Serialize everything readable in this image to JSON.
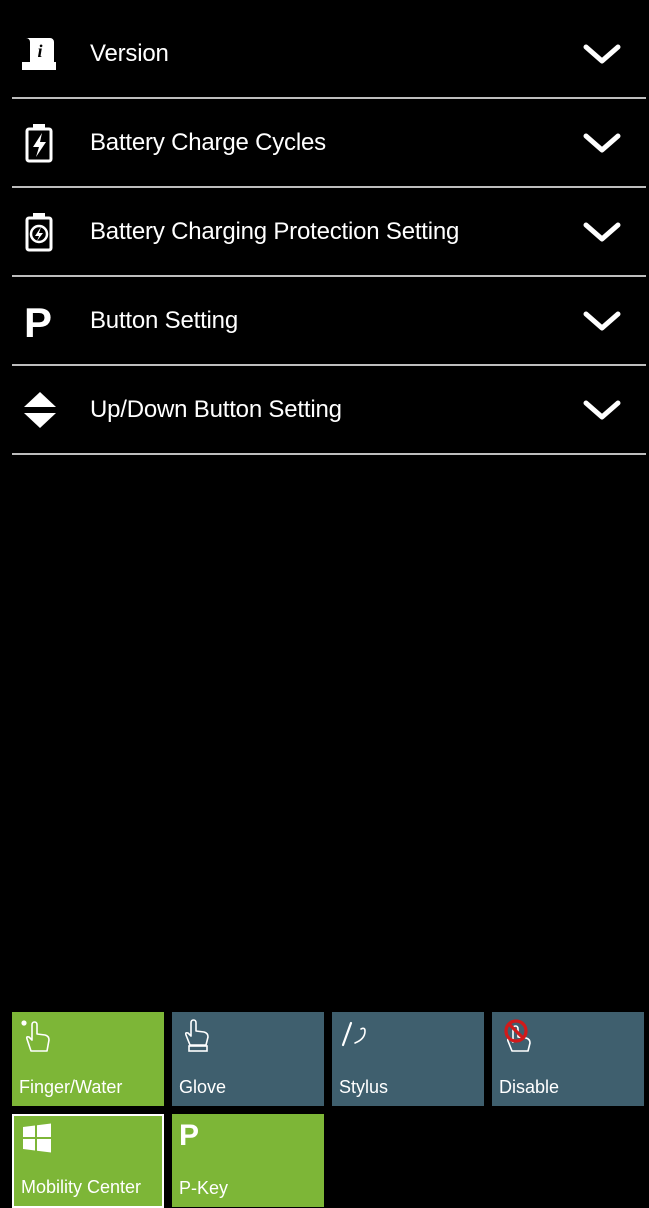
{
  "settings": [
    {
      "label": "Version",
      "icon": "info-scroll-icon"
    },
    {
      "label": "Battery Charge Cycles",
      "icon": "battery-charge-icon"
    },
    {
      "label": "Battery Charging Protection Setting",
      "icon": "battery-protection-icon"
    },
    {
      "label": "Button Setting",
      "icon": "p-button-icon"
    },
    {
      "label": "Up/Down Button Setting",
      "icon": "up-down-arrows-icon"
    }
  ],
  "touch_modes": [
    {
      "label": "Finger/Water",
      "icon": "finger-water-icon",
      "state": "active"
    },
    {
      "label": "Glove",
      "icon": "glove-icon",
      "state": "inactive"
    },
    {
      "label": "Stylus",
      "icon": "stylus-icon",
      "state": "inactive"
    },
    {
      "label": "Disable",
      "icon": "touch-disabled-icon",
      "state": "inactive"
    }
  ],
  "shortcuts": [
    {
      "label": "Mobility Center",
      "icon": "windows-logo-icon"
    },
    {
      "label": "P-Key",
      "icon": "p-key-icon",
      "icon_text": "P"
    }
  ],
  "colors": {
    "active_tile": "#7db637",
    "inactive_tile": "#3f5f6e",
    "background": "#000000",
    "divider": "#bdbdbd",
    "disable_mark": "#d11a1a"
  }
}
